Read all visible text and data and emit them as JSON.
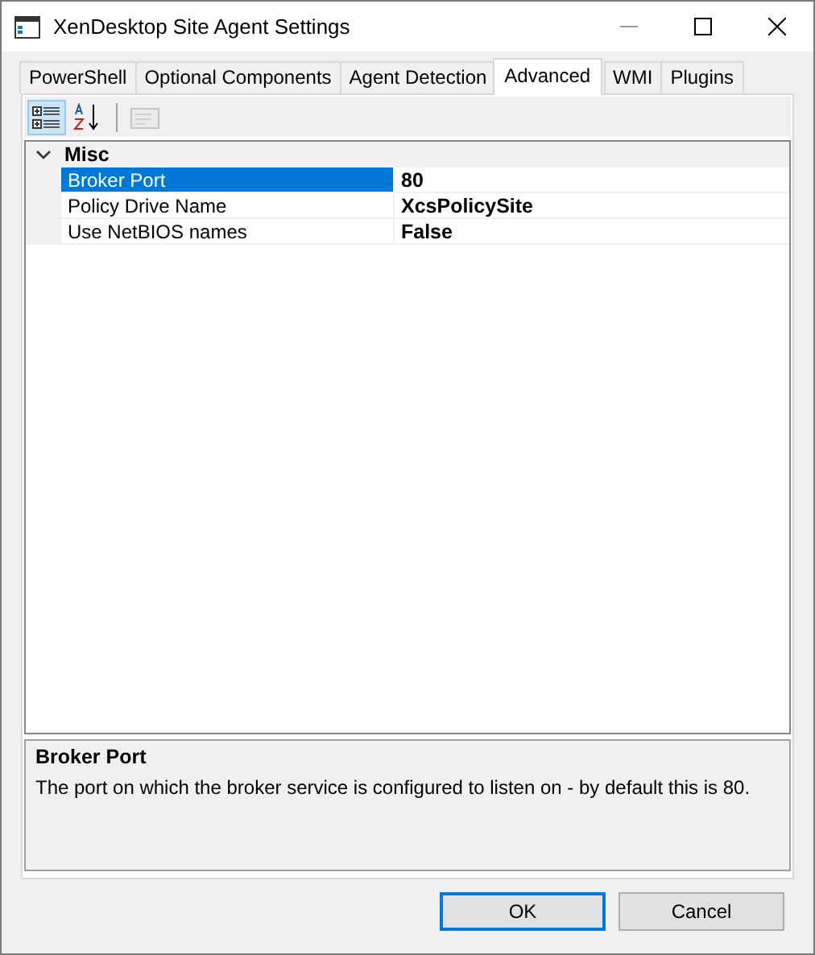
{
  "window": {
    "title": "XenDesktop Site Agent Settings"
  },
  "tabs": [
    {
      "label": "PowerShell",
      "selected": false
    },
    {
      "label": "Optional Components",
      "selected": false
    },
    {
      "label": "Agent Detection",
      "selected": false
    },
    {
      "label": "Advanced",
      "selected": true
    },
    {
      "label": "WMI",
      "selected": false
    },
    {
      "label": "Plugins",
      "selected": false
    }
  ],
  "toolbar": [
    {
      "kind": "categorized",
      "selected": true,
      "disabled": false
    },
    {
      "kind": "alphabetical",
      "selected": false,
      "disabled": false
    },
    {
      "kind": "pages",
      "selected": false,
      "disabled": true
    }
  ],
  "grid": {
    "category": {
      "name": "Misc",
      "expanded": true
    },
    "properties": [
      {
        "name": "Broker Port",
        "value": "80",
        "selected": true
      },
      {
        "name": "Policy Drive Name",
        "value": "XcsPolicySite",
        "selected": false
      },
      {
        "name": "Use NetBIOS names",
        "value": "False",
        "selected": false
      }
    ]
  },
  "description": {
    "title": "Broker Port",
    "text": "The port on which the broker service is configured to listen on - by default this is 80."
  },
  "buttons": [
    {
      "label": "OK",
      "default": true
    },
    {
      "label": "Cancel",
      "default": false
    }
  ]
}
